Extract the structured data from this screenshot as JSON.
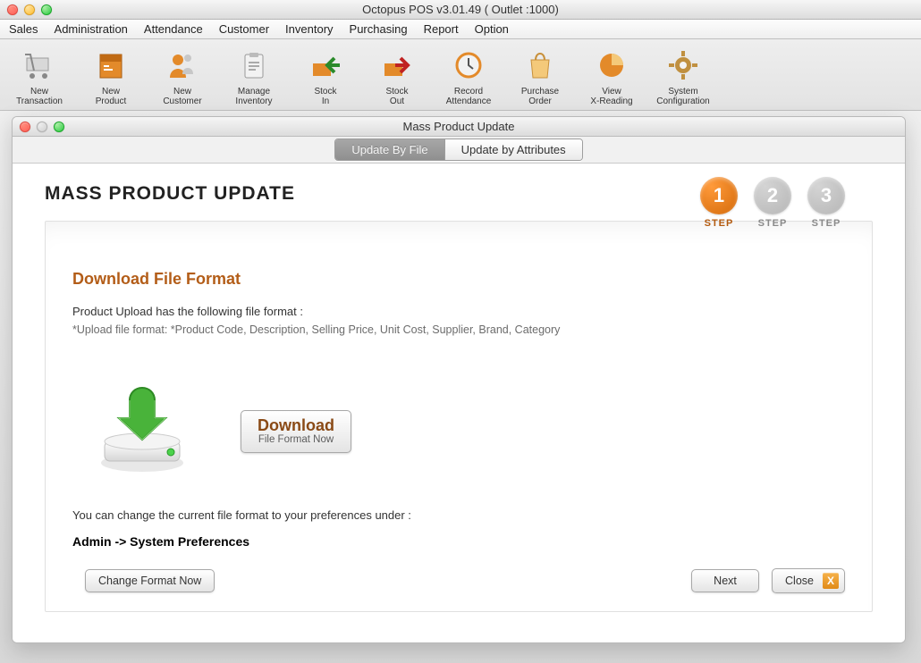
{
  "mainWindow": {
    "title": "Octopus POS v3.01.49 ( Outlet :1000)"
  },
  "menubar": {
    "items": [
      "Sales",
      "Administration",
      "Attendance",
      "Customer",
      "Inventory",
      "Purchasing",
      "Report",
      "Option"
    ]
  },
  "toolbar": {
    "items": [
      {
        "name": "new-transaction",
        "line1": "New",
        "line2": "Transaction"
      },
      {
        "name": "new-product",
        "line1": "New",
        "line2": "Product"
      },
      {
        "name": "new-customer",
        "line1": "New",
        "line2": "Customer"
      },
      {
        "name": "manage-inventory",
        "line1": "Manage",
        "line2": "Inventory"
      },
      {
        "name": "stock-in",
        "line1": "Stock",
        "line2": "In"
      },
      {
        "name": "stock-out",
        "line1": "Stock",
        "line2": "Out"
      },
      {
        "name": "record-attendance",
        "line1": "Record",
        "line2": "Attendance"
      },
      {
        "name": "purchase-order",
        "line1": "Purchase",
        "line2": "Order"
      },
      {
        "name": "view-xreading",
        "line1": "View",
        "line2": "X-Reading"
      },
      {
        "name": "system-configuration",
        "line1": "System",
        "line2": "Configuration"
      }
    ]
  },
  "modal": {
    "title": "Mass Product Update",
    "tabs": {
      "byFile": "Update By File",
      "byAttributes": "Update by Attributes"
    },
    "heading": "MASS PRODUCT UPDATE",
    "steps": [
      {
        "num": "1",
        "label": "STEP",
        "active": true
      },
      {
        "num": "2",
        "label": "STEP",
        "active": false
      },
      {
        "num": "3",
        "label": "STEP",
        "active": false
      }
    ],
    "sectionHeading": "Download File Format",
    "intro": "Product Upload has the following file format :",
    "formatLine": "*Upload file format: *Product Code, Description, Selling Price, Unit Cost, Supplier, Brand, Category",
    "downloadBtn": {
      "title": "Download",
      "sub": "File Format Now"
    },
    "tip": "You can change the current file format to your preferences  under :",
    "tipPath": "Admin -> System Preferences",
    "changeFormatBtn": "Change Format Now",
    "nextBtn": "Next",
    "closeBtn": "Close",
    "closeX": "X"
  }
}
